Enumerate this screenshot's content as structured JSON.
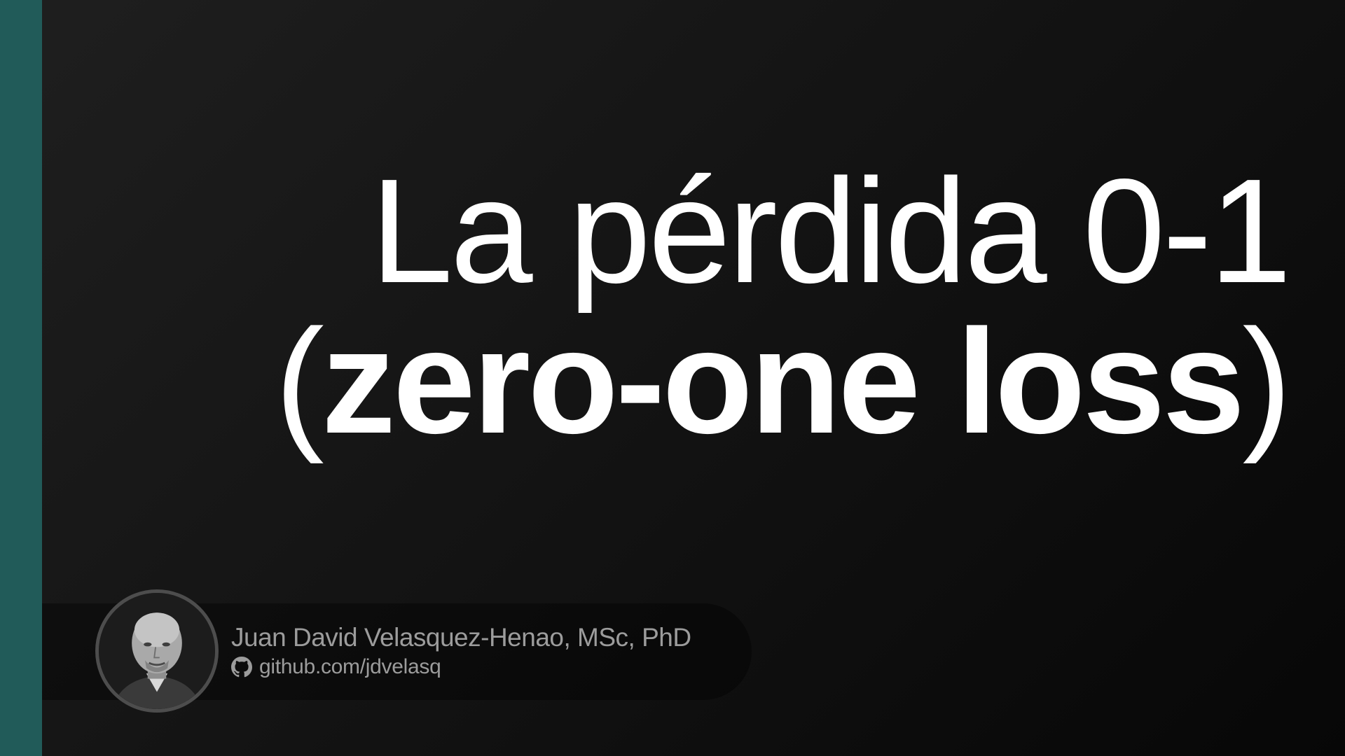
{
  "slide": {
    "title_line1": "La pérdida 0-1",
    "title_line2": {
      "open_paren": "(",
      "bold_text": "zero-one loss",
      "close_paren": ")"
    }
  },
  "author": {
    "name": "Juan David Velasquez-Henao, MSc, PhD",
    "link_icon": "github-icon",
    "link_text": "github.com/jdvelasq"
  },
  "colors": {
    "accent_bar": "#215b59",
    "background": "#141414",
    "title_text": "#ffffff",
    "author_text": "#9c9c9c"
  }
}
